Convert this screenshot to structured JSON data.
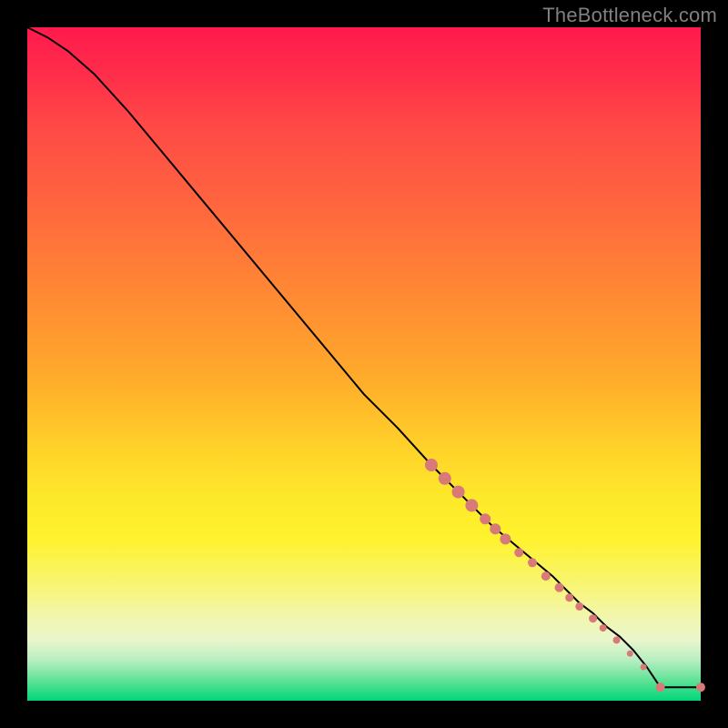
{
  "attribution": "TheBottleneck.com",
  "chart_data": {
    "type": "line",
    "title": "",
    "xlabel": "",
    "ylabel": "",
    "xlim": [
      0,
      100
    ],
    "ylim": [
      0,
      100
    ],
    "grid": false,
    "series": [
      {
        "name": "curve",
        "color": "#000000",
        "x": [
          0,
          3,
          6,
          10,
          15,
          20,
          25,
          30,
          35,
          40,
          45,
          50,
          55,
          60,
          63,
          66,
          69,
          72,
          75,
          78,
          80,
          82,
          84,
          86,
          88,
          90,
          92,
          94,
          100
        ],
        "y": [
          100,
          98.5,
          96.5,
          93,
          87.5,
          81.5,
          75.5,
          69.5,
          63.5,
          57.5,
          51.5,
          45.5,
          40.5,
          35,
          32,
          29,
          26,
          23.5,
          21,
          18.5,
          16.5,
          14.5,
          13,
          11,
          9.5,
          7.5,
          5,
          2,
          2
        ]
      }
    ],
    "markers": {
      "color": "#d77a78",
      "points": [
        {
          "x": 60,
          "y": 35,
          "r": 7
        },
        {
          "x": 62,
          "y": 33,
          "r": 7
        },
        {
          "x": 64,
          "y": 31,
          "r": 7
        },
        {
          "x": 66,
          "y": 29,
          "r": 7
        },
        {
          "x": 68,
          "y": 27,
          "r": 6
        },
        {
          "x": 69.5,
          "y": 25.5,
          "r": 6
        },
        {
          "x": 71,
          "y": 24,
          "r": 6
        },
        {
          "x": 73,
          "y": 22,
          "r": 5
        },
        {
          "x": 75,
          "y": 20.5,
          "r": 5
        },
        {
          "x": 77,
          "y": 18.5,
          "r": 5
        },
        {
          "x": 79,
          "y": 16.8,
          "r": 5
        },
        {
          "x": 80.5,
          "y": 15.3,
          "r": 4.5
        },
        {
          "x": 82,
          "y": 14,
          "r": 4.5
        },
        {
          "x": 84,
          "y": 12.2,
          "r": 4.5
        },
        {
          "x": 85.5,
          "y": 10.8,
          "r": 4
        },
        {
          "x": 87.5,
          "y": 9,
          "r": 4
        },
        {
          "x": 89.5,
          "y": 7,
          "r": 3.5
        },
        {
          "x": 91.5,
          "y": 5,
          "r": 3.5
        },
        {
          "x": 94,
          "y": 2,
          "r": 5
        },
        {
          "x": 100,
          "y": 2,
          "r": 5
        }
      ]
    }
  }
}
